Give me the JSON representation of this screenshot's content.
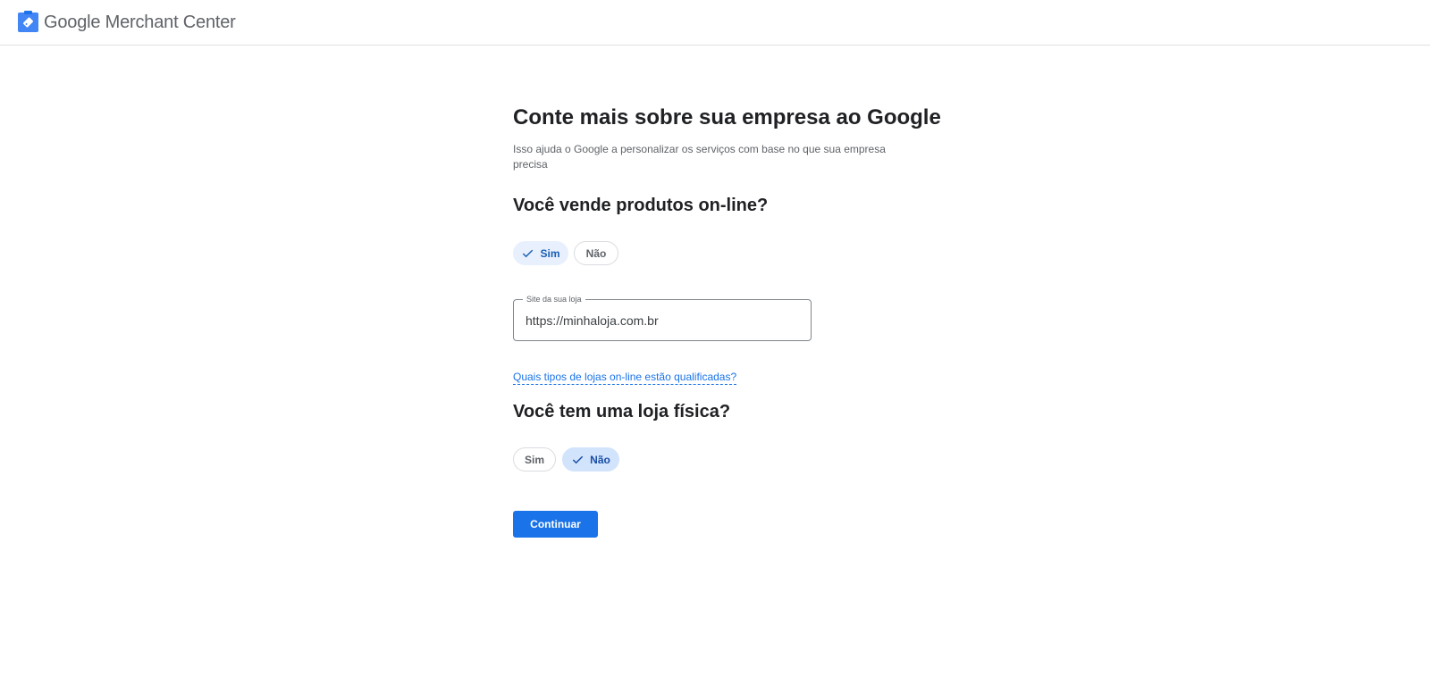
{
  "header": {
    "logo_google": "Google",
    "logo_product": "Merchant Center",
    "icon": "merchant-center-tag-icon"
  },
  "main": {
    "title": "Conte mais sobre sua empresa ao Google",
    "subtitle": "Isso ajuda o Google a personalizar os serviços com base no que sua empresa precisa",
    "online_question": {
      "heading": "Você vende produtos on-line?",
      "options": [
        "Sim",
        "Não"
      ],
      "selected": "Sim"
    },
    "website_field": {
      "label": "Site da sua loja",
      "value": "https://minhaloja.com.br"
    },
    "help_link": "Quais tipos de lojas on-line estão qualificadas?",
    "physical_question": {
      "heading": "Você tem uma loja física?",
      "options": [
        "Sim",
        "Não"
      ],
      "selected": "Não"
    },
    "continue_label": "Continuar"
  },
  "colors": {
    "primary": "#1a73e8",
    "chip_selected_bg": "#e8f0fe",
    "text_primary": "#202124",
    "text_secondary": "#5f6368"
  }
}
